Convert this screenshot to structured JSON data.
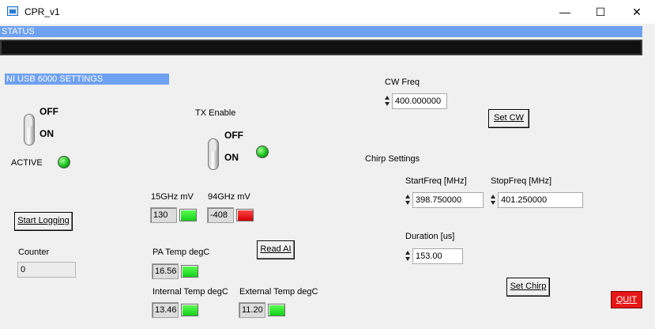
{
  "window": {
    "title": "CPR_v1",
    "minimize": "—",
    "maximize": "☐",
    "close": "✕"
  },
  "status": {
    "label": "STATUS",
    "value": ""
  },
  "section": {
    "label": "NI USB 6000 SETTINGS"
  },
  "active_switch": {
    "off": "OFF",
    "on": "ON",
    "active_label": "ACTIVE"
  },
  "tx": {
    "label": "TX Enable",
    "off": "OFF",
    "on": "ON"
  },
  "cw": {
    "label": "CW Freq",
    "value": "400.000000",
    "set_button": "Set CW"
  },
  "chirp": {
    "label": "Chirp Settings",
    "start_label": "StartFreq [MHz]",
    "start_value": "398.750000",
    "stop_label": "StopFreq [MHz]",
    "stop_value": "401.250000",
    "duration_label": "Duration [us]",
    "duration_value": "153.00",
    "set_button": "Set Chirp"
  },
  "logging": {
    "button": "Start Logging",
    "counter_label": "Counter",
    "counter_value": "0"
  },
  "readings": {
    "ghz15_label": "15GHz mV",
    "ghz15_value": "130",
    "ghz94_label": "94GHz mV",
    "ghz94_value": "-408",
    "pa_label": "PA Temp degC",
    "pa_value": "16.56",
    "int_label": "Internal Temp degC",
    "int_value": "13.46",
    "ext_label": "External Temp degC",
    "ext_value": "11.20"
  },
  "read_ai_button": "Read AI",
  "quit_button": "QUIT",
  "colors": {
    "accent": "#6fa1f1",
    "led_green": "#17d11c",
    "led_red": "#d40000",
    "quit": "#e81717"
  }
}
